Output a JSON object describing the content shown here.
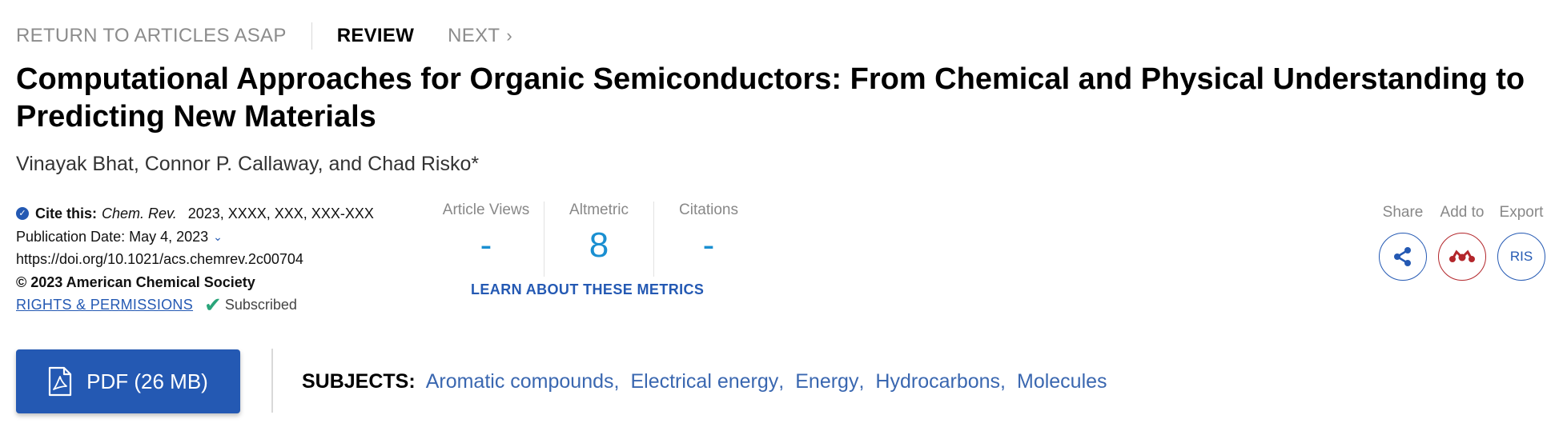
{
  "topnav": {
    "return_label": "RETURN TO ARTICLES ASAP",
    "section_label": "REVIEW",
    "next_label": "NEXT"
  },
  "article": {
    "title": "Computational Approaches for Organic Semiconductors: From Chemical and Physical Understanding to Predicting New Materials",
    "authors": "Vinayak Bhat, Connor P. Callaway, and Chad Risko*"
  },
  "citation": {
    "cite_label": "Cite this:",
    "journal": "Chem. Rev.",
    "details": "2023, XXXX, XXX, XXX-XXX",
    "publication_date": "Publication Date: May 4, 2023",
    "doi": "https://doi.org/10.1021/acs.chemrev.2c00704",
    "copyright": "© 2023 American Chemical Society",
    "rights_label": "RIGHTS & PERMISSIONS",
    "subscribed_label": "Subscribed"
  },
  "metrics": {
    "items": [
      {
        "label": "Article Views",
        "value": "-"
      },
      {
        "label": "Altmetric",
        "value": "8"
      },
      {
        "label": "Citations",
        "value": "-"
      }
    ],
    "learn_label": "LEARN ABOUT THESE METRICS"
  },
  "actions": {
    "share_label": "Share",
    "addto_label": "Add to",
    "export_label": "Export",
    "export_button": "RIS"
  },
  "pdf": {
    "label": "PDF (26 MB)"
  },
  "subjects": {
    "label": "SUBJECTS:",
    "items": [
      "Aromatic compounds",
      "Electrical energy",
      "Energy",
      "Hydrocarbons",
      "Molecules"
    ]
  },
  "colors": {
    "accent": "#2459b3",
    "metric_value": "#1a8fd1",
    "mendeley_red": "#b3262b",
    "subscribed_green": "#2aa57a"
  },
  "icons": [
    "chevron-right-icon",
    "check-circle-icon",
    "chevron-down-icon",
    "checkmark-icon",
    "share-icon",
    "mendeley-icon",
    "pdf-file-icon"
  ]
}
